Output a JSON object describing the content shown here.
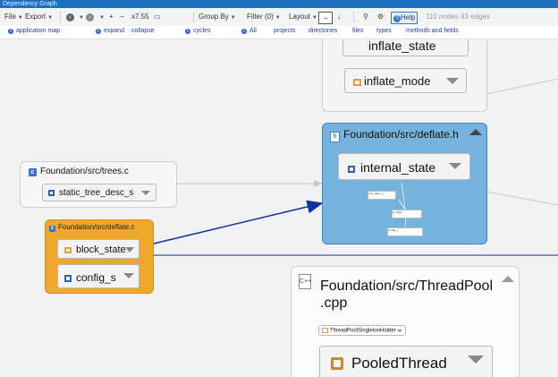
{
  "window": {
    "title": "Dependency Graph"
  },
  "toolbar": {
    "file": "File",
    "export": "Export",
    "zoom": "x7.55",
    "group_by": "Group By",
    "filter": "Filter (0)",
    "layout": "Layout",
    "help": "Help",
    "stats": "110 nodes 43 edges"
  },
  "links": {
    "application_map": "application map",
    "expand": "expand",
    "collapse": "collapse",
    "cycles": "cycles",
    "all": "All",
    "projects": "projects",
    "directories": "directories",
    "files": "files",
    "types": "types",
    "methods_fields": "methods and fields"
  },
  "graph": {
    "inflate_group": {
      "top_node": "inflate_state",
      "node": "inflate_mode"
    },
    "deflate_h": {
      "title": "Foundation/src/deflate.h",
      "node": "internal_state",
      "tiny": [
        "tree_desc_s",
        "ct_data",
        "config_s"
      ]
    },
    "trees_c": {
      "title": "Foundation/src/trees.c",
      "node": "static_tree_desc_s"
    },
    "deflate_c": {
      "title": "Foundation/src/deflate.c",
      "nodes": [
        "block_state",
        "config_s"
      ]
    },
    "threadpool": {
      "title_line1": "Foundation/src/ThreadPool",
      "title_line2": ".cpp",
      "small_node": "ThreadPoolSingletonHolder",
      "node": "PooledThread"
    },
    "colors": {
      "selected_group": "#76b3dc",
      "deflate_c_group": "#f0a82c",
      "edge_highlight": "#1530a0"
    }
  }
}
